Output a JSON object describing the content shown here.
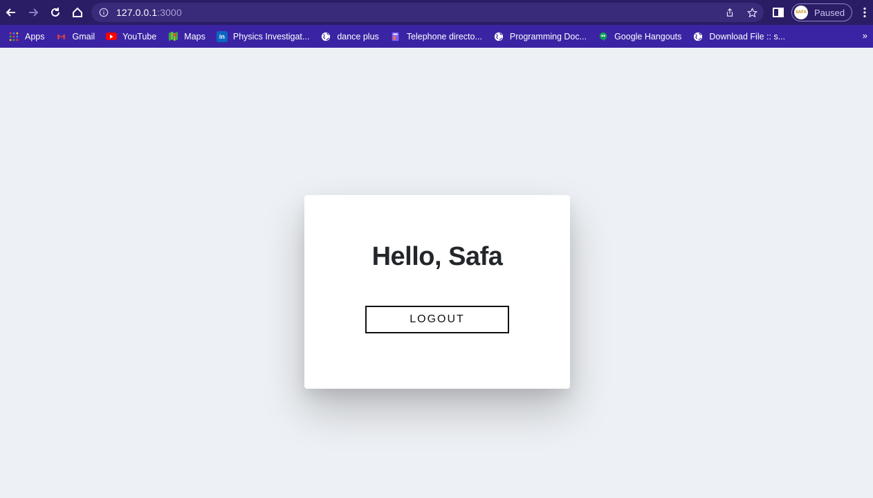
{
  "browser": {
    "url_host": "127.0.0.1",
    "url_port": ":3000",
    "profile_status": "Paused",
    "profile_avatar_text": "SAFA"
  },
  "bookmarks": [
    {
      "label": "Apps",
      "icon": "apps-grid-icon",
      "color": "#ea4335"
    },
    {
      "label": "Gmail",
      "icon": "gmail-icon",
      "color": "#ea4335"
    },
    {
      "label": "YouTube",
      "icon": "youtube-icon",
      "color": "#ff0000"
    },
    {
      "label": "Maps",
      "icon": "maps-icon",
      "color": "#34a853"
    },
    {
      "label": "Physics Investigat...",
      "icon": "linkedin-icon",
      "color": "#0a66c2"
    },
    {
      "label": "dance plus",
      "icon": "globe-icon",
      "color": "#ffffff"
    },
    {
      "label": "Telephone directo...",
      "icon": "directory-icon",
      "color": "#7b61ff"
    },
    {
      "label": "Programming Doc...",
      "icon": "globe-icon",
      "color": "#ffffff"
    },
    {
      "label": "Google Hangouts",
      "icon": "hangouts-icon",
      "color": "#0f9d58"
    },
    {
      "label": "Download File :: s...",
      "icon": "globe-icon",
      "color": "#ffffff"
    }
  ],
  "page": {
    "greeting": "Hello, Safa",
    "logout_label": "LOGOUT"
  },
  "colors": {
    "toolbar_bg": "#2b1c66",
    "bookmarks_bg": "#3a24a4",
    "page_bg": "#edf0f4"
  }
}
